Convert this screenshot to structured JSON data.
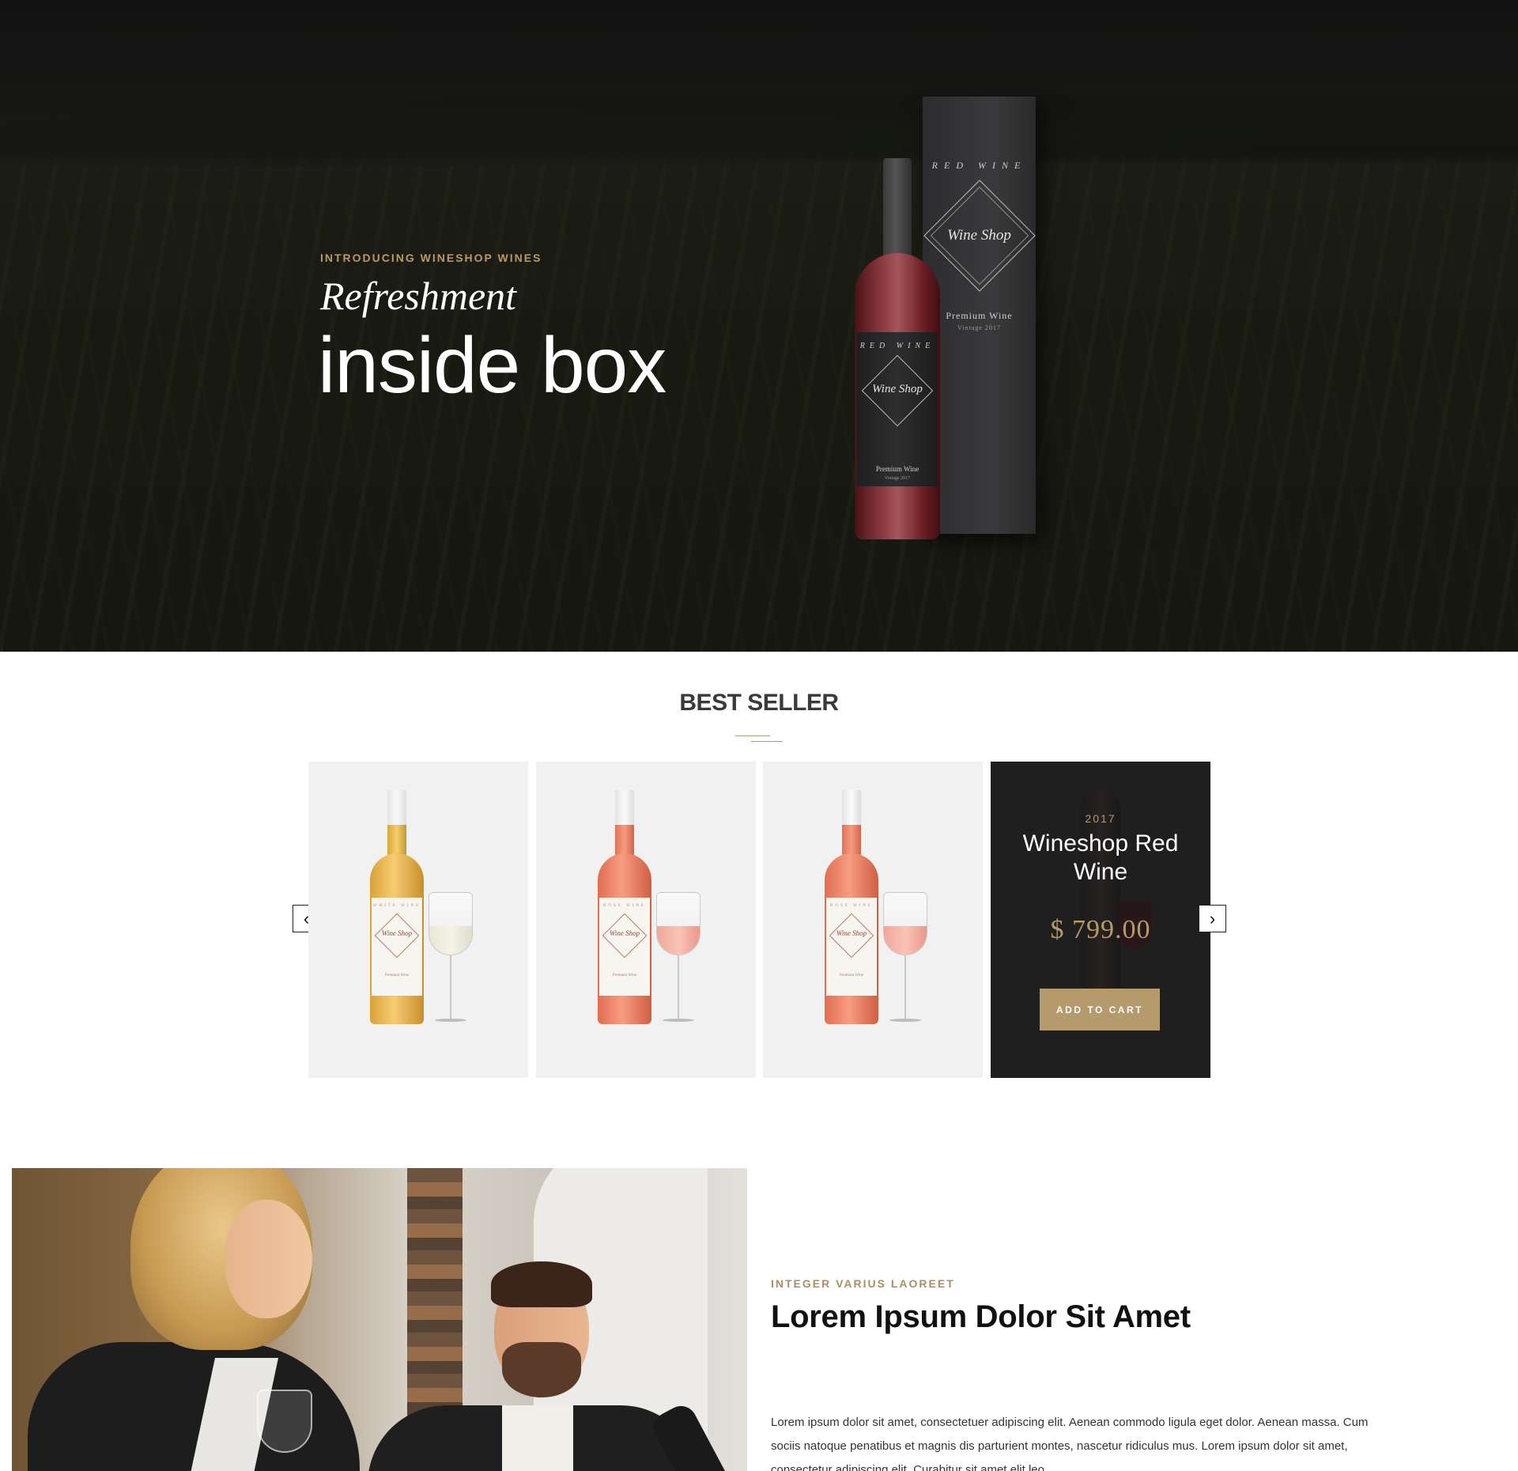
{
  "hero": {
    "kicker": "INTRODUCING WINESHOP WINES",
    "title_italic": "Refreshment",
    "title_big": "inside box",
    "product": {
      "box_label": "RED WINE",
      "brand": "Wine Shop",
      "premium": "Premium Wine",
      "vintage": "Vintage 2017"
    }
  },
  "best_seller": {
    "title": "BEST SELLER",
    "prev_arrow": "‹",
    "next_arrow": "›",
    "cards": [
      {
        "kind": "white",
        "label_top": "WHITE WINE",
        "brand": "Wine Shop",
        "premium": "Premium Wine"
      },
      {
        "kind": "rose",
        "label_top": "ROSE WINE",
        "brand": "Wine Shop",
        "premium": "Premium Wine"
      },
      {
        "kind": "rose",
        "label_top": "ROSE WINE",
        "brand": "Wine Shop",
        "premium": "Premium Wine"
      }
    ],
    "featured": {
      "year": "2017",
      "name": "Wineshop Red Wine",
      "price": "$ 799.00",
      "cta": "ADD TO CART"
    }
  },
  "about": {
    "kicker": "INTEGER VARIUS LAOREET",
    "title": "Lorem Ipsum Dolor Sit Amet",
    "text": "Lorem ipsum dolor sit amet, consectetuer adipiscing elit. Aenean commodo ligula eget dolor. Aenean massa. Cum sociis natoque penatibus et magnis dis parturient montes, nascetur ridiculus mus. Lorem ipsum dolor sit amet, consectetur adipiscing elit. Curabitur sit amet elit leo."
  },
  "colors": {
    "accent_gold": "#b79a66",
    "button_gold": "#b49a6c",
    "dark_card": "#1f1f1f",
    "light_card": "#f1f1f1"
  }
}
